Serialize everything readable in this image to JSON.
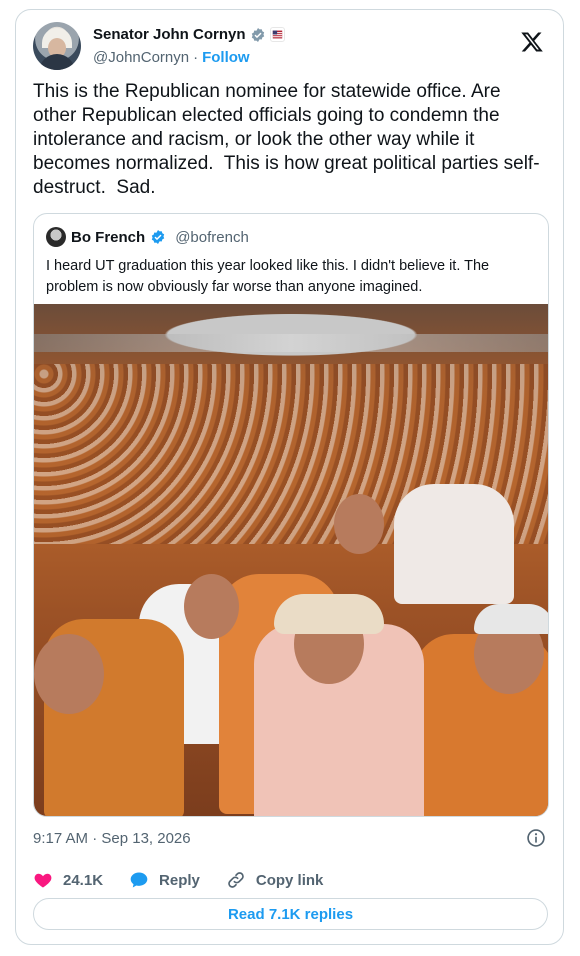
{
  "author": {
    "name": "Senator John Cornyn",
    "handle": "@JohnCornyn",
    "separator": "·",
    "follow_label": "Follow"
  },
  "tweet": {
    "text": "This is the Republican nominee for statewide office. Are other Republican elected officials going to condemn the intolerance and racism, or look the other way while it becomes normalized.  This is how great political parties self-destruct.  Sad."
  },
  "quote": {
    "name": "Bo French",
    "handle": "@bofrench",
    "text": "I heard UT graduation this year looked like this. I didn't believe it. The problem is now obviously far worse than anyone imagined."
  },
  "meta": {
    "timestamp": "9:17 AM · Sep 13, 2026"
  },
  "actions": {
    "likes": "24.1K",
    "reply_label": "Reply",
    "copy_label": "Copy link"
  },
  "read_replies_label": "Read 7.1K replies",
  "colors": {
    "accent": "#1d9bf0",
    "like": "#f91880",
    "text": "#0f1419",
    "muted": "#536471",
    "border": "#cfd9de"
  },
  "icons": {
    "verified": "verified-badge-icon",
    "x_logo": "x-logo-icon",
    "info": "info-icon",
    "like": "heart-icon",
    "reply": "reply-bubble-icon",
    "copy": "link-icon"
  }
}
